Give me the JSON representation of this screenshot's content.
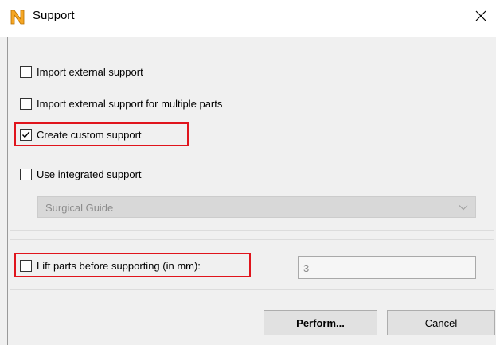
{
  "window": {
    "title": "Support",
    "app_icon": "nettfabb-n-logo-icon",
    "close_icon": "close-icon",
    "accent_color": "#f5a623",
    "highlight_color": "#e0141c"
  },
  "options": [
    {
      "label": "Import external support",
      "checked": false
    },
    {
      "label": "Import external support for multiple parts",
      "checked": false
    },
    {
      "label": "Create custom support",
      "checked": true
    },
    {
      "label": "Use integrated support",
      "checked": false
    }
  ],
  "integrated_support": {
    "selected": "Surgical Guide",
    "disabled": true
  },
  "lift": {
    "label": "Lift parts before supporting (in mm):",
    "checked": false,
    "value": "3"
  },
  "buttons": {
    "perform_label": "Perform...",
    "cancel_label": "Cancel"
  }
}
